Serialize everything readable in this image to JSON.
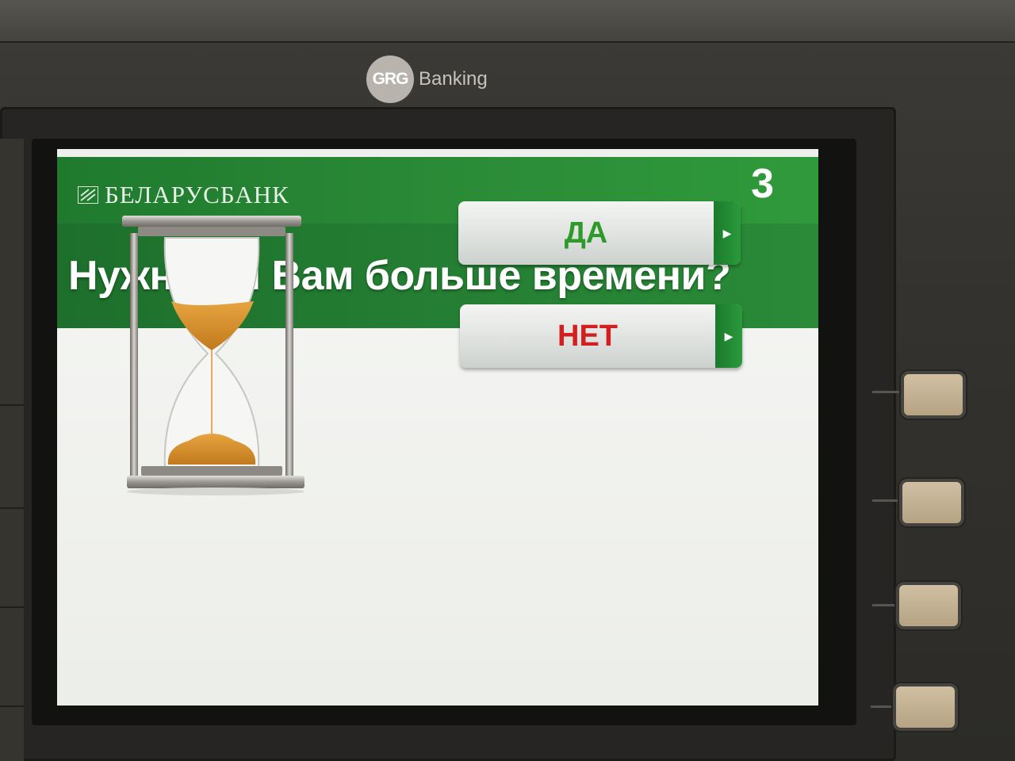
{
  "terminal": {
    "manufacturer": "GRG",
    "manufacturer_suffix": "Banking"
  },
  "screen": {
    "bank_name": "БЕЛАРУСБАНК",
    "step_number": "3",
    "question": "Нужно ли Вам больше времени?",
    "options": [
      {
        "label": "ДА",
        "color": "#2f9a2c"
      },
      {
        "label": "НЕТ",
        "color": "#d31f1f"
      }
    ],
    "colors": {
      "header_green": "#2c8d38",
      "button_tab_green": "#2a9a3c"
    }
  },
  "icons": {
    "hourglass": "hourglass-icon",
    "bank_mark": "belarusbank-mark-icon",
    "button_arrow": "chevron-right-icon"
  }
}
